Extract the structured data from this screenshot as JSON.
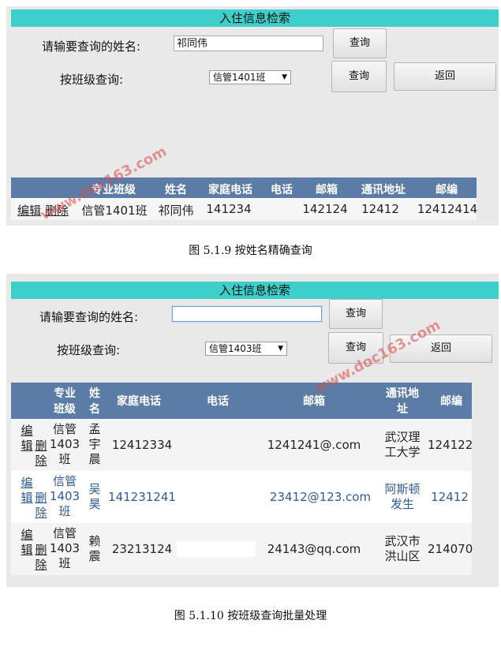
{
  "shot1": {
    "title": "入住信息检索",
    "name_label": "请输要查询的姓名:",
    "name_value": "祁同伟",
    "class_label": "按班级查询:",
    "class_value": "信管1401班",
    "query_label": "查询",
    "back_label": "返回",
    "headers": [
      "专业班级",
      "姓名",
      "家庭电话",
      "电话",
      "邮箱",
      "通讯地址",
      "邮编"
    ],
    "row": {
      "edit": "编辑",
      "del": "删除",
      "cells": [
        "信管1401班",
        "祁同伟",
        "141234",
        "",
        "142124",
        "12412",
        "12412414"
      ]
    }
  },
  "caption1": "图 5.1.9 按姓名精确查询",
  "shot2": {
    "title": "入住信息检索",
    "name_label": "请输要查询的姓名:",
    "name_value": "",
    "class_label": "按班级查询:",
    "class_value": "信管1403班",
    "query_label": "查询",
    "back_label": "返回",
    "headers": [
      [
        "专业",
        "班级"
      ],
      [
        "姓",
        "名"
      ],
      [
        "家庭电话"
      ],
      [
        "电话"
      ],
      [
        "邮箱"
      ],
      [
        "通讯地",
        "址"
      ],
      [
        "邮编"
      ]
    ],
    "rows": [
      {
        "edit": [
          "编",
          "辑"
        ],
        "del": [
          "删",
          "除"
        ],
        "cls": [
          "信管",
          "1403",
          "班"
        ],
        "name": [
          "孟",
          "宇",
          "晨"
        ],
        "home": "12412334",
        "phone": "",
        "email": "1241241@.com",
        "addr": [
          "武汉理",
          "工大学"
        ],
        "zip": "124122"
      },
      {
        "edit": [
          "编",
          "辑"
        ],
        "del": [
          "删",
          "除"
        ],
        "cls": [
          "信管",
          "1403",
          "班"
        ],
        "name": [
          "吴",
          "昊"
        ],
        "home": "141231241",
        "phone": "",
        "email": "23412@123.com",
        "addr": [
          "阿斯顿",
          "发生"
        ],
        "zip": "12412"
      },
      {
        "edit": [
          "编",
          "辑"
        ],
        "del": [
          "删",
          "除"
        ],
        "cls": [
          "信管",
          "1403",
          "班"
        ],
        "name": [
          "赖",
          "震"
        ],
        "home": "23213124",
        "phone": "",
        "email": "24143@qq.com",
        "addr": [
          "武汉市",
          "洪山区"
        ],
        "zip": "214070"
      }
    ]
  },
  "caption2": "图 5.1.10 按班级查询批量处理",
  "watermark": "www.doc163.com",
  "colors": {
    "title_bar": "#3ecfcb",
    "table_header": "#5b7ca6",
    "link_blue": "#2f5a93",
    "watermark": "#d94b4b"
  }
}
